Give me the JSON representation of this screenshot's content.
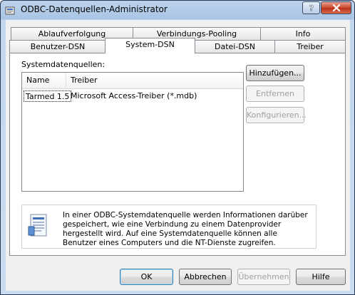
{
  "window": {
    "title": "ODBC-Datenquellen-Administrator",
    "help_symbol": "?",
    "close_symbol": "×"
  },
  "tabs": {
    "row_back": [
      "Ablaufverfolgung",
      "Verbindungs-Pooling",
      "Info"
    ],
    "row_front": [
      "Benutzer-DSN",
      "System-DSN",
      "Datei-DSN",
      "Treiber"
    ],
    "selected": "System-DSN"
  },
  "panel": {
    "label": "Systemdatenquellen:",
    "list": {
      "columns": [
        "Name",
        "Treiber"
      ],
      "rows": [
        {
          "name": "Tarmed 1.5",
          "driver": "Microsoft Access-Treiber (*.mdb)"
        }
      ]
    },
    "buttons": {
      "add": "Hinzufügen...",
      "remove": "Entfernen",
      "configure": "Konfigurieren..."
    },
    "info_text": "In einer ODBC-Systemdatenquelle werden Informationen darüber gespeichert, wie eine Verbindung zu einem Datenprovider hergestellt wird. Auf eine Systemdatenquelle können alle Benutzer eines Computers und die NT-Dienste zugreifen."
  },
  "footer": {
    "ok": "OK",
    "cancel": "Abbrechen",
    "apply": "Übernehmen",
    "help": "Hilfe"
  }
}
